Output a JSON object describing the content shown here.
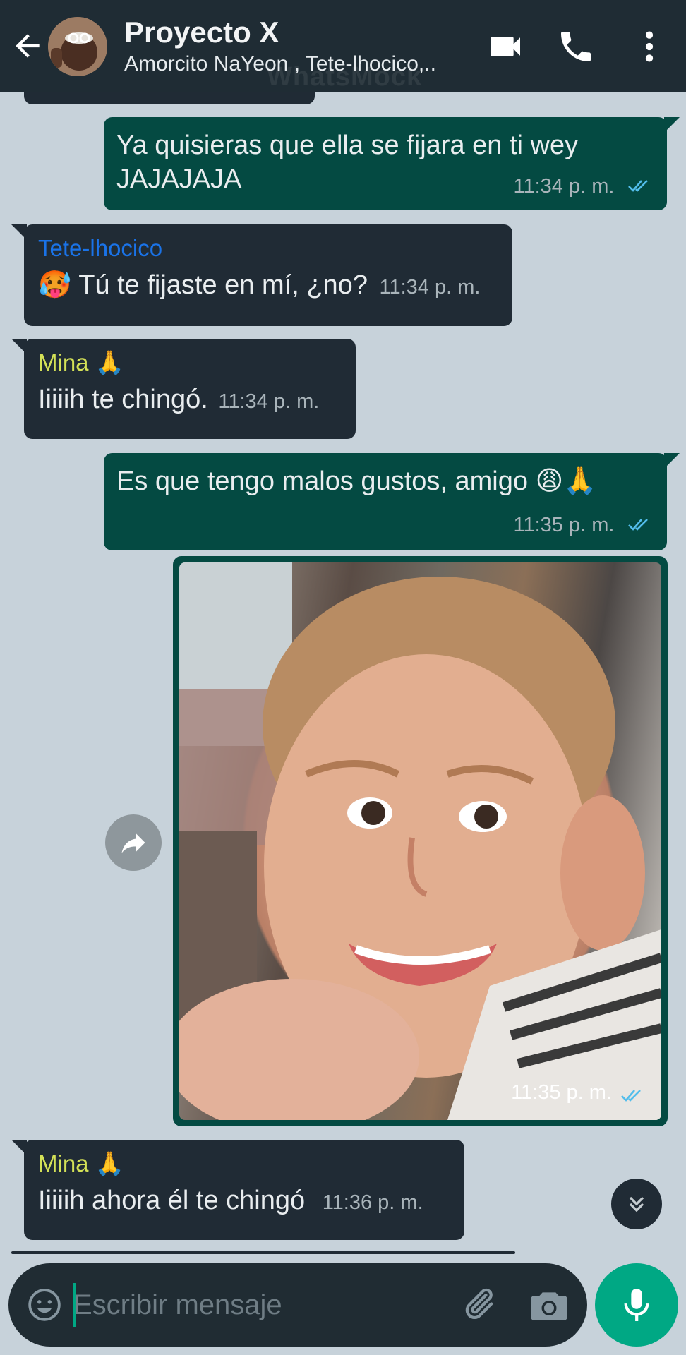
{
  "header": {
    "title": "Proyecto X",
    "subtitle": "Amorcito NaYeon , Tete-lhocico,..",
    "watermark": "WhatsMock"
  },
  "colors": {
    "header_bg": "#1f2c34",
    "chat_bg": "#c7d2da",
    "incoming_bubble": "#202b35",
    "outgoing_bubble": "#044a42",
    "accent": "#00a884",
    "read_ticks": "#53bdeb",
    "sender_tete": "#1a73e8",
    "sender_mina": "#d4e157"
  },
  "messages": [
    {
      "direction": "out",
      "text": "Ya quisieras que ella se fijara en ti wey JAJAJAJA",
      "time": "11:34 p. m.",
      "status": "read"
    },
    {
      "direction": "in",
      "sender": "Tete-lhocico",
      "emoji": "🥵",
      "text": "Tú te fijaste en mí, ¿no?",
      "time": "11:34 p. m."
    },
    {
      "direction": "in",
      "sender": "Mina 🙏",
      "text": "Iiiiih te chingó.",
      "time": "11:34 p. m."
    },
    {
      "direction": "out",
      "text": "Es que tengo malos gustos, amigo 😩🙏",
      "time": "11:35 p. m.",
      "status": "read"
    },
    {
      "direction": "out",
      "type": "image",
      "image_desc_icon": "photo",
      "time": "11:35 p. m.",
      "status": "read"
    },
    {
      "direction": "in",
      "sender": "Mina 🙏",
      "text": "Iiiiih ahora él te chingó",
      "time": "11:36 p. m."
    }
  ],
  "input": {
    "placeholder": "Escribir mensaje"
  },
  "icons": {
    "back": "arrow-left-icon",
    "video": "video-call-icon",
    "call": "phone-icon",
    "menu": "more-vert-icon",
    "forward": "forward-icon",
    "scroll": "chevron-double-down-icon",
    "emoji": "emoji-icon",
    "attach": "paperclip-icon",
    "camera": "camera-icon",
    "mic": "microphone-icon"
  }
}
